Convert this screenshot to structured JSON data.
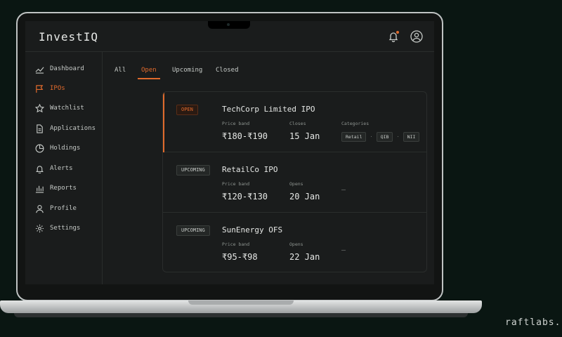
{
  "app": {
    "title": "InvestIQ"
  },
  "brand": "raftlabs.",
  "sidebar": {
    "items": [
      {
        "label": "Dashboard",
        "icon": "trend-icon",
        "active": false
      },
      {
        "label": "IPOs",
        "icon": "flag-icon",
        "active": true
      },
      {
        "label": "Watchlist",
        "icon": "star-icon",
        "active": false
      },
      {
        "label": "Applications",
        "icon": "document-icon",
        "active": false
      },
      {
        "label": "Holdings",
        "icon": "pie-chart-icon",
        "active": false
      },
      {
        "label": "Alerts",
        "icon": "bell-icon",
        "active": false
      },
      {
        "label": "Reports",
        "icon": "bar-chart-icon",
        "active": false
      },
      {
        "label": "Profile",
        "icon": "user-icon",
        "active": false
      },
      {
        "label": "Settings",
        "icon": "gear-icon",
        "active": false
      }
    ]
  },
  "tabs": [
    {
      "label": "All",
      "active": false
    },
    {
      "label": "Open",
      "active": true
    },
    {
      "label": "Upcoming",
      "active": false
    },
    {
      "label": "Closed",
      "active": false
    }
  ],
  "ipos": [
    {
      "status": "OPEN",
      "name": "TechCorp Limited IPO",
      "price_label": "Price band",
      "price": "₹180-₹190",
      "date_label": "Closes",
      "date": "15 Jan",
      "categories_label": "Categories",
      "categories": [
        "Retail",
        "QIB",
        "NII"
      ]
    },
    {
      "status": "UPCOMING",
      "name": "RetailCo IPO",
      "price_label": "Price band",
      "price": "₹120-₹130",
      "date_label": "Opens",
      "date": "20 Jan",
      "placeholder": "—"
    },
    {
      "status": "UPCOMING",
      "name": "SunEnergy OFS",
      "price_label": "Price band",
      "price": "₹95-₹98",
      "date_label": "Opens",
      "date": "22 Jan",
      "placeholder": "—"
    }
  ],
  "colors": {
    "accent": "#e06a2c",
    "background": "#0a1612",
    "panel": "#1a1c1c"
  }
}
